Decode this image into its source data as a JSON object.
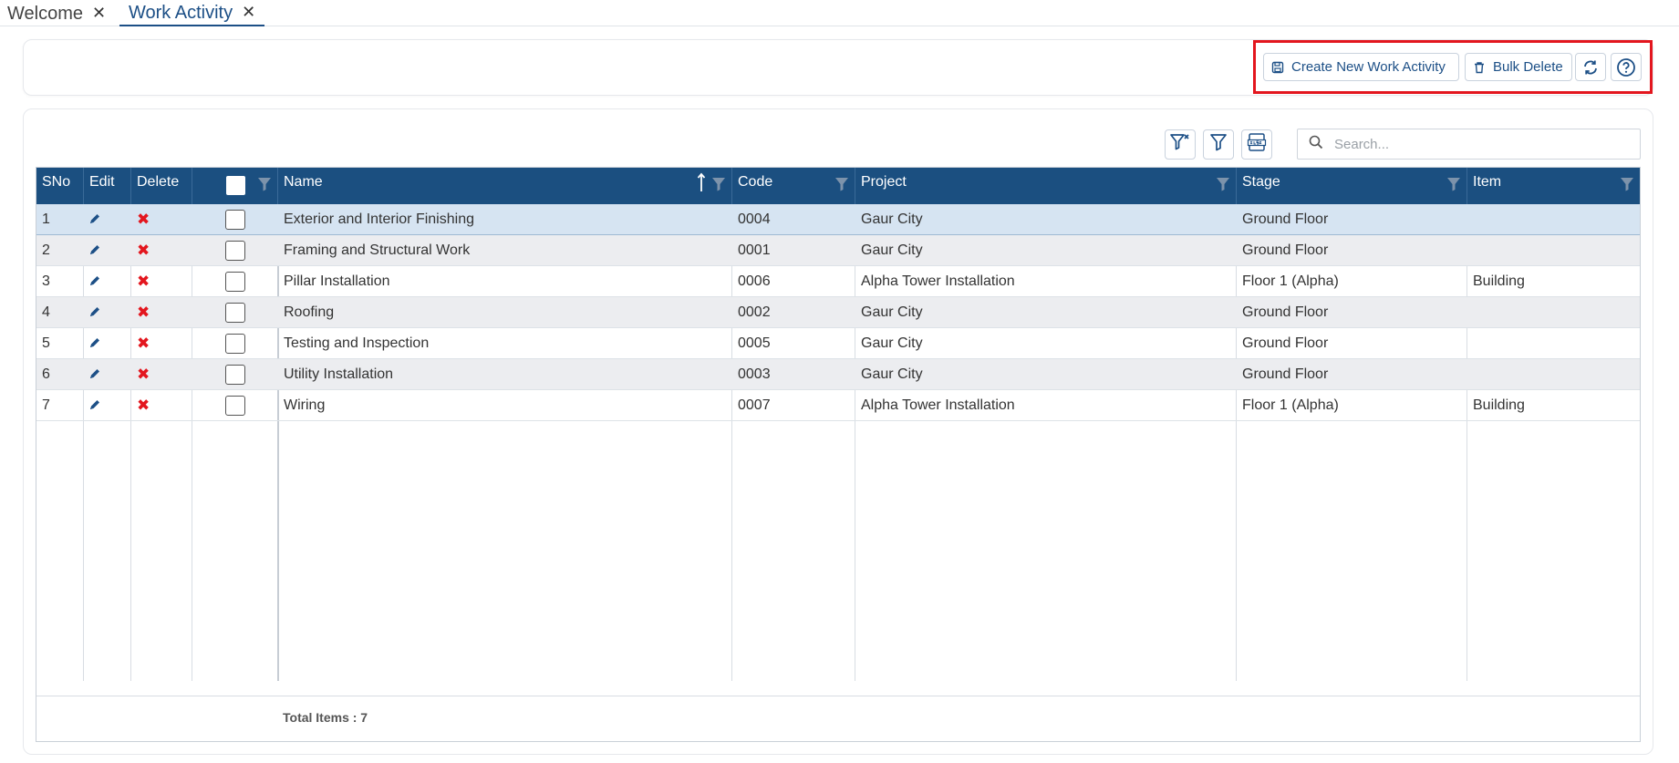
{
  "tabs": [
    {
      "label": "Welcome",
      "close": "✕"
    },
    {
      "label": "Work Activity",
      "close": "✕"
    }
  ],
  "toolbar": {
    "create_label": "Create New Work Activity",
    "bulk_delete_label": "Bulk Delete"
  },
  "search": {
    "placeholder": "Search..."
  },
  "columns": [
    "SNo",
    "Edit",
    "Delete",
    "",
    "Name",
    "Code",
    "Project",
    "Stage",
    "Item"
  ],
  "rows": [
    {
      "sno": "1",
      "name": "Exterior and Interior Finishing",
      "code": "0004",
      "project": "Gaur City",
      "stage": "Ground Floor",
      "item": ""
    },
    {
      "sno": "2",
      "name": "Framing and Structural Work",
      "code": "0001",
      "project": "Gaur City",
      "stage": "Ground Floor",
      "item": ""
    },
    {
      "sno": "3",
      "name": "Pillar Installation",
      "code": "0006",
      "project": "Alpha Tower Installation",
      "stage": "Floor 1 (Alpha)",
      "item": "Building"
    },
    {
      "sno": "4",
      "name": "Roofing",
      "code": "0002",
      "project": "Gaur City",
      "stage": "Ground Floor",
      "item": ""
    },
    {
      "sno": "5",
      "name": "Testing and Inspection",
      "code": "0005",
      "project": "Gaur City",
      "stage": "Ground Floor",
      "item": ""
    },
    {
      "sno": "6",
      "name": "Utility Installation",
      "code": "0003",
      "project": "Gaur City",
      "stage": "Ground Floor",
      "item": ""
    },
    {
      "sno": "7",
      "name": "Wiring",
      "code": "0007",
      "project": "Alpha Tower Installation",
      "stage": "Floor 1 (Alpha)",
      "item": "Building"
    }
  ],
  "footer": {
    "total": "Total Items : 7"
  },
  "icons": {
    "edit": "pencil-icon",
    "delete": "delete-x-icon",
    "clear_filter": "filter-clear-icon",
    "filter": "filter-icon",
    "export": "xlsx-export-icon",
    "refresh": "refresh-icon",
    "help": "help-icon",
    "save": "save-icon",
    "trash": "trash-icon",
    "search": "search-icon",
    "sort": "sort-ascending-icon"
  },
  "colors": {
    "header_bg": "#1b4f80",
    "accent": "#1c4f86",
    "delete_red": "#e3161e",
    "highlight_border": "#e3161e",
    "selected_row": "#d6e4f2",
    "alt_row": "#ecedf0"
  }
}
